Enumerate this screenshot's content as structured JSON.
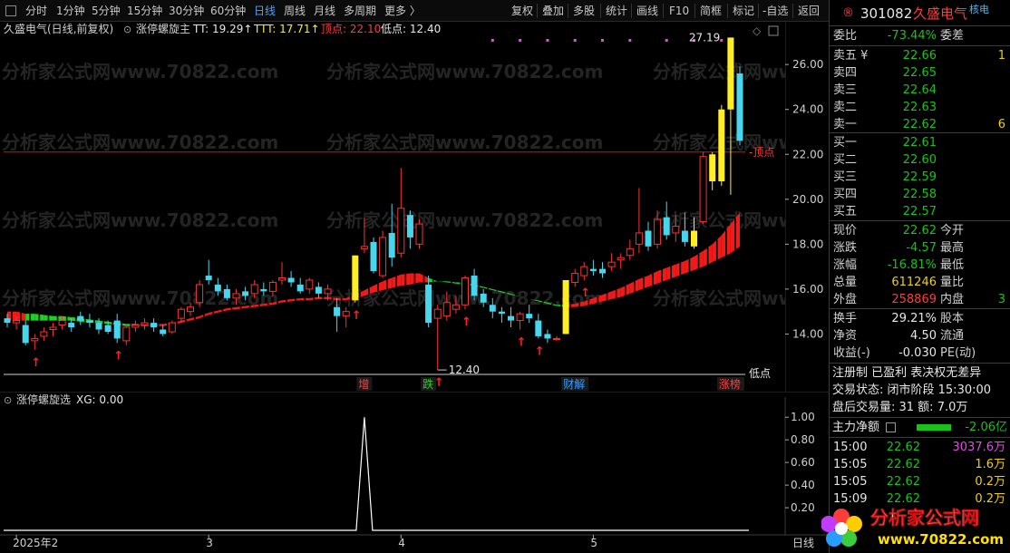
{
  "toolbar": {
    "left_items": [
      "分时",
      "1分钟",
      "5分钟",
      "15分钟",
      "30分钟",
      "60分钟",
      "日线",
      "周线",
      "月线",
      "多周期",
      "更多 〉"
    ],
    "active": "日线",
    "right_items": [
      "复权",
      "叠加",
      "多股",
      "统计",
      "画线",
      "F10",
      "简框",
      "标记",
      "-自选",
      "返回"
    ]
  },
  "main_header": {
    "stock_title": "久盛电气(日线,前复权)",
    "indicator_name": "涨停螺旋主",
    "tt_label": "TT: 19.29↑",
    "ttt_label": "TTT: 17.71↑",
    "top_label": "顶点: 22.10",
    "low_label": "低点: 12.40"
  },
  "watermark": "分析家公式网www.70822.com",
  "price_axis": [
    "26.00",
    "24.00",
    "22.00",
    "20.00",
    "18.00",
    "16.00",
    "14.00"
  ],
  "chart_data": [
    {
      "type": "candlestick",
      "title": "久盛电气(日线,前复权)",
      "ylim": [
        12.0,
        27.5
      ],
      "top_line": 22.1,
      "top_line_label": "顶点",
      "low_marker": 12.4,
      "low_marker_label": "12.40",
      "high_marker_label": "27.19",
      "bottom_right_label": "低点",
      "candles": [
        {
          "o": 14.7,
          "h": 14.9,
          "l": 14.3,
          "c": 14.5
        },
        {
          "o": 14.5,
          "h": 14.8,
          "l": 14.2,
          "c": 14.6
        },
        {
          "o": 14.4,
          "h": 14.6,
          "l": 13.5,
          "c": 13.6
        },
        {
          "o": 13.7,
          "h": 14.0,
          "l": 13.3,
          "c": 13.8
        },
        {
          "o": 13.9,
          "h": 14.3,
          "l": 13.7,
          "c": 14.1
        },
        {
          "o": 14.2,
          "h": 14.5,
          "l": 13.9,
          "c": 14.3
        },
        {
          "o": 14.4,
          "h": 14.8,
          "l": 14.2,
          "c": 14.6
        },
        {
          "o": 14.5,
          "h": 14.7,
          "l": 14.1,
          "c": 14.3
        },
        {
          "o": 14.8,
          "h": 15.0,
          "l": 14.4,
          "c": 14.6
        },
        {
          "o": 14.6,
          "h": 14.9,
          "l": 14.3,
          "c": 14.5
        },
        {
          "o": 14.5,
          "h": 14.7,
          "l": 14.0,
          "c": 14.2
        },
        {
          "o": 14.4,
          "h": 14.6,
          "l": 14.0,
          "c": 14.1
        },
        {
          "o": 14.6,
          "h": 14.9,
          "l": 13.6,
          "c": 13.8
        },
        {
          "o": 13.7,
          "h": 14.4,
          "l": 13.5,
          "c": 14.3
        },
        {
          "o": 14.3,
          "h": 14.6,
          "l": 14.1,
          "c": 14.4
        },
        {
          "o": 14.4,
          "h": 14.7,
          "l": 14.2,
          "c": 14.5
        },
        {
          "o": 14.5,
          "h": 14.7,
          "l": 14.1,
          "c": 14.3
        },
        {
          "o": 14.2,
          "h": 14.4,
          "l": 13.9,
          "c": 14.0
        },
        {
          "o": 14.1,
          "h": 14.6,
          "l": 14.0,
          "c": 14.5
        },
        {
          "o": 14.7,
          "h": 15.2,
          "l": 14.5,
          "c": 15.1
        },
        {
          "o": 15.0,
          "h": 15.4,
          "l": 14.8,
          "c": 15.2
        },
        {
          "o": 15.4,
          "h": 16.4,
          "l": 15.2,
          "c": 16.2
        },
        {
          "o": 16.6,
          "h": 17.3,
          "l": 16.2,
          "c": 16.4
        },
        {
          "o": 16.2,
          "h": 16.5,
          "l": 15.7,
          "c": 15.9
        },
        {
          "o": 16.0,
          "h": 16.2,
          "l": 15.5,
          "c": 15.6
        },
        {
          "o": 15.6,
          "h": 16.0,
          "l": 15.3,
          "c": 15.8
        },
        {
          "o": 15.9,
          "h": 16.1,
          "l": 15.5,
          "c": 15.7
        },
        {
          "o": 15.8,
          "h": 16.4,
          "l": 15.6,
          "c": 16.2
        },
        {
          "o": 16.0,
          "h": 16.3,
          "l": 15.7,
          "c": 15.9
        },
        {
          "o": 15.9,
          "h": 16.4,
          "l": 15.7,
          "c": 16.3
        },
        {
          "o": 16.4,
          "h": 17.2,
          "l": 16.2,
          "c": 16.5
        },
        {
          "o": 16.5,
          "h": 16.8,
          "l": 16.1,
          "c": 16.3
        },
        {
          "o": 16.2,
          "h": 16.5,
          "l": 15.8,
          "c": 15.9
        },
        {
          "o": 16.0,
          "h": 16.5,
          "l": 15.8,
          "c": 16.4
        },
        {
          "o": 16.1,
          "h": 16.3,
          "l": 15.6,
          "c": 15.8
        },
        {
          "o": 15.8,
          "h": 16.2,
          "l": 15.5,
          "c": 16.0
        },
        {
          "o": 15.2,
          "h": 15.6,
          "l": 14.1,
          "c": 14.8
        },
        {
          "o": 14.8,
          "h": 15.2,
          "l": 14.3,
          "c": 15.0
        },
        {
          "o": 15.5,
          "h": 17.5,
          "l": 15.4,
          "c": 17.5
        },
        {
          "o": 17.8,
          "h": 19.2,
          "l": 17.6,
          "c": 17.9
        },
        {
          "o": 18.1,
          "h": 18.3,
          "l": 16.7,
          "c": 16.8
        },
        {
          "o": 16.6,
          "h": 18.6,
          "l": 16.5,
          "c": 18.3
        },
        {
          "o": 18.5,
          "h": 19.8,
          "l": 17.0,
          "c": 17.4
        },
        {
          "o": 17.6,
          "h": 21.4,
          "l": 17.4,
          "c": 19.6
        },
        {
          "o": 19.3,
          "h": 19.5,
          "l": 17.8,
          "c": 18.3
        },
        {
          "o": 18.0,
          "h": 19.1,
          "l": 17.8,
          "c": 18.9
        },
        {
          "o": 16.2,
          "h": 16.6,
          "l": 14.3,
          "c": 14.5
        },
        {
          "o": 14.7,
          "h": 15.3,
          "l": 12.4,
          "c": 15.1
        },
        {
          "o": 14.8,
          "h": 15.9,
          "l": 14.6,
          "c": 15.4
        },
        {
          "o": 15.1,
          "h": 15.7,
          "l": 14.9,
          "c": 15.3
        },
        {
          "o": 15.3,
          "h": 16.6,
          "l": 15.1,
          "c": 16.5
        },
        {
          "o": 16.6,
          "h": 16.9,
          "l": 15.5,
          "c": 15.7
        },
        {
          "o": 15.8,
          "h": 16.0,
          "l": 15.2,
          "c": 15.4
        },
        {
          "o": 15.3,
          "h": 15.6,
          "l": 14.7,
          "c": 15.0
        },
        {
          "o": 15.0,
          "h": 15.2,
          "l": 14.5,
          "c": 14.9
        },
        {
          "o": 14.8,
          "h": 15.2,
          "l": 14.3,
          "c": 14.6
        },
        {
          "o": 14.6,
          "h": 15.0,
          "l": 14.2,
          "c": 14.9
        },
        {
          "o": 14.9,
          "h": 15.3,
          "l": 14.5,
          "c": 14.7
        },
        {
          "o": 14.6,
          "h": 14.9,
          "l": 13.8,
          "c": 13.9
        },
        {
          "o": 14.0,
          "h": 14.2,
          "l": 13.6,
          "c": 13.8
        },
        {
          "o": 13.8,
          "h": 13.9,
          "l": 13.7,
          "c": 13.8
        },
        {
          "o": 14.0,
          "h": 16.4,
          "l": 14.0,
          "c": 16.4
        },
        {
          "o": 16.3,
          "h": 16.9,
          "l": 16.1,
          "c": 16.7
        },
        {
          "o": 16.6,
          "h": 17.2,
          "l": 16.4,
          "c": 17.0
        },
        {
          "o": 16.9,
          "h": 17.3,
          "l": 16.6,
          "c": 16.8
        },
        {
          "o": 16.9,
          "h": 17.2,
          "l": 16.5,
          "c": 16.7
        },
        {
          "o": 17.0,
          "h": 17.6,
          "l": 16.8,
          "c": 17.2
        },
        {
          "o": 17.3,
          "h": 17.6,
          "l": 16.9,
          "c": 17.4
        },
        {
          "o": 17.5,
          "h": 18.2,
          "l": 17.3,
          "c": 17.8
        },
        {
          "o": 18.0,
          "h": 20.5,
          "l": 17.6,
          "c": 18.5
        },
        {
          "o": 18.6,
          "h": 19.0,
          "l": 17.7,
          "c": 17.9
        },
        {
          "o": 18.0,
          "h": 19.5,
          "l": 17.8,
          "c": 19.1
        },
        {
          "o": 19.2,
          "h": 19.9,
          "l": 18.2,
          "c": 18.4
        },
        {
          "o": 18.5,
          "h": 19.3,
          "l": 18.1,
          "c": 18.8
        },
        {
          "o": 18.6,
          "h": 19.4,
          "l": 17.9,
          "c": 18.1
        },
        {
          "o": 17.9,
          "h": 19.2,
          "l": 17.8,
          "c": 18.6
        },
        {
          "o": 19.0,
          "h": 22.1,
          "l": 18.9,
          "c": 21.9
        },
        {
          "o": 22.0,
          "h": 22.1,
          "l": 20.4,
          "c": 20.8
        },
        {
          "o": 20.8,
          "h": 24.2,
          "l": 20.6,
          "c": 24.0
        },
        {
          "o": 24.0,
          "h": 27.2,
          "l": 20.2,
          "c": 27.2
        },
        {
          "o": 25.6,
          "h": 25.9,
          "l": 22.4,
          "c": 22.6
        }
      ],
      "ribbon_top": [
        15.0,
        15.0,
        14.9,
        14.9,
        14.85,
        14.8,
        14.8,
        14.75,
        14.7,
        14.65,
        14.6,
        14.55,
        14.5,
        14.45,
        14.45,
        14.45,
        14.45,
        14.45,
        14.5,
        14.6,
        14.7,
        14.8,
        14.95,
        15.05,
        15.15,
        15.2,
        15.25,
        15.3,
        15.35,
        15.4,
        15.5,
        15.55,
        15.6,
        15.6,
        15.65,
        15.65,
        15.6,
        15.6,
        15.75,
        15.95,
        16.15,
        16.35,
        16.5,
        16.65,
        16.7,
        16.7,
        16.5,
        16.35,
        16.3,
        16.25,
        16.2,
        16.15,
        16.05,
        15.95,
        15.85,
        15.75,
        15.65,
        15.55,
        15.5,
        15.4,
        15.3,
        15.3,
        15.35,
        15.45,
        15.6,
        15.75,
        15.9,
        16.05,
        16.25,
        16.45,
        16.6,
        16.8,
        16.95,
        17.1,
        17.25,
        17.45,
        17.7,
        18.0,
        18.4,
        18.9,
        19.4
      ],
      "ribbon_bottom": [
        14.6,
        14.6,
        14.6,
        14.6,
        14.6,
        14.6,
        14.6,
        14.6,
        14.55,
        14.5,
        14.5,
        14.45,
        14.4,
        14.35,
        14.35,
        14.35,
        14.35,
        14.35,
        14.4,
        14.5,
        14.6,
        14.7,
        14.85,
        14.95,
        15.05,
        15.1,
        15.15,
        15.2,
        15.25,
        15.3,
        15.4,
        15.45,
        15.5,
        15.5,
        15.55,
        15.55,
        15.5,
        15.5,
        15.6,
        15.7,
        15.85,
        15.95,
        16.05,
        16.15,
        16.2,
        16.3,
        16.3,
        16.35,
        16.35,
        16.3,
        16.3,
        16.2,
        16.1,
        16.0,
        15.9,
        15.8,
        15.65,
        15.55,
        15.45,
        15.35,
        15.25,
        15.2,
        15.2,
        15.25,
        15.35,
        15.45,
        15.55,
        15.65,
        15.8,
        15.95,
        16.1,
        16.25,
        16.4,
        16.55,
        16.7,
        16.85,
        17.0,
        17.2,
        17.4,
        17.6,
        17.9
      ],
      "ribbon_colors": [
        "red",
        "red",
        "green",
        "green",
        "green",
        "green",
        "green",
        "green",
        "green",
        "green",
        "green",
        "green",
        "green",
        "green",
        "red",
        "red",
        "red",
        "red",
        "red",
        "red",
        "red",
        "red",
        "red",
        "red",
        "red",
        "red",
        "red",
        "red",
        "red",
        "red",
        "red",
        "red",
        "red",
        "red",
        "red",
        "red",
        "red",
        "red",
        "red",
        "red",
        "red",
        "red",
        "red",
        "red",
        "red",
        "red",
        "green",
        "green",
        "green",
        "green",
        "green",
        "green",
        "green",
        "green",
        "green",
        "green",
        "green",
        "green",
        "green",
        "green",
        "green",
        "red",
        "red",
        "red",
        "red",
        "red",
        "red",
        "red",
        "red",
        "red",
        "red",
        "red",
        "red",
        "red",
        "red",
        "red",
        "red",
        "red",
        "red",
        "red",
        "red"
      ],
      "yellow_bars": [
        38,
        61,
        75,
        77,
        78,
        79
      ],
      "up_arrows": [
        3,
        12,
        38,
        47,
        50,
        56,
        58,
        63
      ],
      "signal_squares": [
        53,
        56,
        59,
        62,
        65,
        68,
        72,
        75,
        78
      ],
      "tags": [
        {
          "index": 39,
          "label": "增",
          "color": "#ff4040"
        },
        {
          "index": 46,
          "label": "跌",
          "color": "#30d030"
        },
        {
          "index": 62,
          "label": "财解",
          "color": "#3a9cff"
        },
        {
          "index": 79,
          "label": "涨榜",
          "color": "#ff4040"
        }
      ],
      "x_labels": [
        {
          "index": 1,
          "label": "2025年2"
        },
        {
          "index": 22,
          "label": "3"
        },
        {
          "index": 43,
          "label": "4"
        },
        {
          "index": 64,
          "label": "5"
        }
      ]
    },
    {
      "type": "line",
      "title": "涨停螺旋选",
      "series": [
        {
          "name": "XG",
          "values_at": {
            "index": 39,
            "value": 1.0
          }
        }
      ],
      "ylim": [
        0,
        1.05
      ],
      "ticks": [
        "1.00",
        "0.80",
        "0.60",
        "0.40",
        "0.20"
      ]
    }
  ],
  "sub_header": {
    "indicator_name": "涨停螺旋选",
    "xg_label": "XG: 0.00"
  },
  "period_label": "日线",
  "quote": {
    "code": "301082",
    "name": "久盛电气",
    "badge": "核电",
    "weibi_label": "委比",
    "weibi_value": "-73.44%",
    "weicha_label": "委差",
    "asks": [
      {
        "label": "卖五",
        "price": "22.66",
        "vol": "1"
      },
      {
        "label": "卖四",
        "price": "22.65",
        "vol": ""
      },
      {
        "label": "卖三",
        "price": "22.64",
        "vol": ""
      },
      {
        "label": "卖二",
        "price": "22.63",
        "vol": ""
      },
      {
        "label": "卖一",
        "price": "22.62",
        "vol": "6"
      }
    ],
    "bids": [
      {
        "label": "买一",
        "price": "22.61"
      },
      {
        "label": "买二",
        "price": "22.60"
      },
      {
        "label": "买三",
        "price": "22.59"
      },
      {
        "label": "买四",
        "price": "22.58"
      },
      {
        "label": "买五",
        "price": "22.57"
      }
    ],
    "stats": [
      {
        "l1": "现价",
        "v1": "22.62",
        "c1": "green",
        "l2": "今开",
        "v2": ""
      },
      {
        "l1": "涨跌",
        "v1": "-4.57",
        "c1": "green",
        "l2": "最高",
        "v2": ""
      },
      {
        "l1": "涨幅",
        "v1": "-16.81%",
        "c1": "green",
        "l2": "最低",
        "v2": ""
      },
      {
        "l1": "总量",
        "v1": "611246",
        "c1": "yellow",
        "l2": "量比",
        "v2": ""
      },
      {
        "l1": "外盘",
        "v1": "258869",
        "c1": "red",
        "l2": "内盘",
        "v2": "3"
      }
    ],
    "stats2": [
      {
        "l1": "换手",
        "v1": "29.21%",
        "l2": "股本"
      },
      {
        "l1": "净资",
        "v1": "4.50",
        "l2": "流通"
      },
      {
        "l1": "收益(-)",
        "v1": "-0.030",
        "l2": "PE(动)"
      }
    ],
    "reg_line": "注册制  已盈利  表决权无差异",
    "trade_status": "交易状态: 闭市阶段 15:30:00",
    "after_hours": "盘后交易量: 31  额: 7.0万",
    "main_net_label": "主力净额",
    "main_net_value": "-2.06亿",
    "ticks": [
      {
        "time": "15:00",
        "price": "22.62",
        "vol": "3037.6万",
        "vcolor": "magenta"
      },
      {
        "time": "15:05",
        "price": "22.62",
        "vol": "1.6万",
        "vcolor": "yellow"
      },
      {
        "time": "15:05",
        "price": "22.62",
        "vol": "0.2万",
        "vcolor": "yellow"
      },
      {
        "time": "15:09",
        "price": "22.62",
        "vol": "0.2万",
        "vcolor": "yellow"
      }
    ]
  },
  "logo": {
    "text": "分析家公式网",
    "url": "www.70822.com"
  },
  "colors": {
    "up": "#ff3030",
    "down": "#46d7ee",
    "ribbon_green": "#22dd22",
    "ribbon_red": "#ff1a1a",
    "yellow": "#ffee22",
    "topline": "#d01818"
  }
}
